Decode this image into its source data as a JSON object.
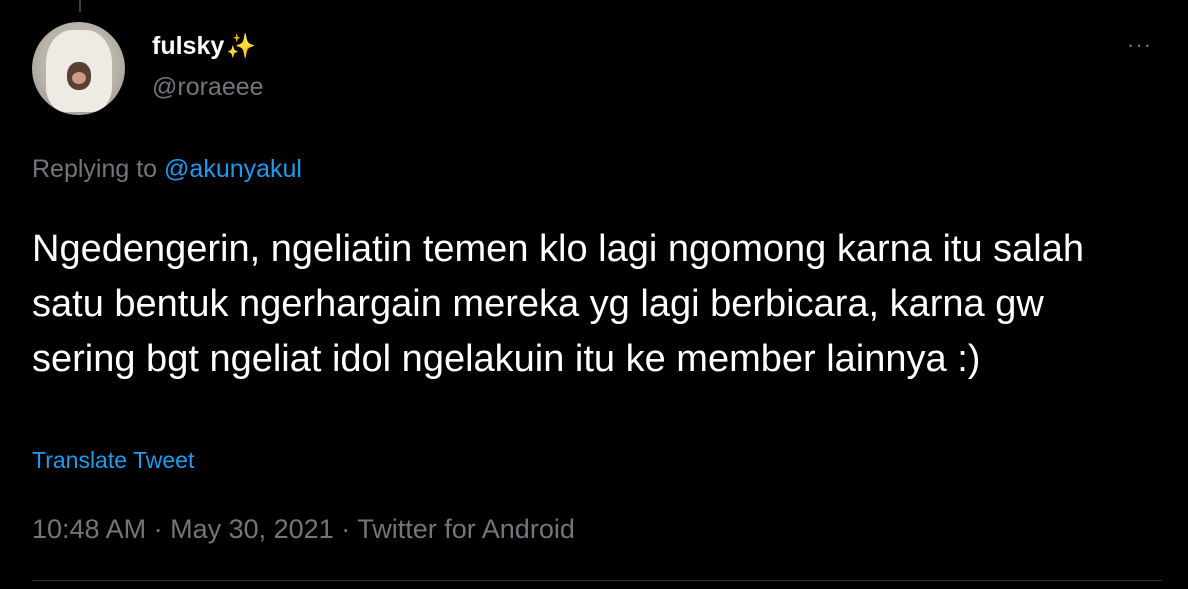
{
  "tweet": {
    "display_name": "fulsky",
    "name_emoji": "✨",
    "handle": "@roraeee",
    "more_icon": "···",
    "replying_prefix": "Replying to",
    "replying_to": "@akunyakul",
    "text": "Ngedengerin, ngeliatin temen klo lagi ngomong karna itu salah satu bentuk ngerhargain mereka yg lagi berbicara, karna gw sering bgt ngeliat idol ngelakuin itu ke member lainnya :)",
    "translate_label": "Translate Tweet",
    "time": "10:48 AM",
    "date": "May 30, 2021",
    "source": "Twitter for Android",
    "separator": "·"
  },
  "colors": {
    "background": "#000000",
    "text_primary": "#ffffff",
    "text_secondary": "#71767b",
    "link": "#1d9bf0"
  }
}
